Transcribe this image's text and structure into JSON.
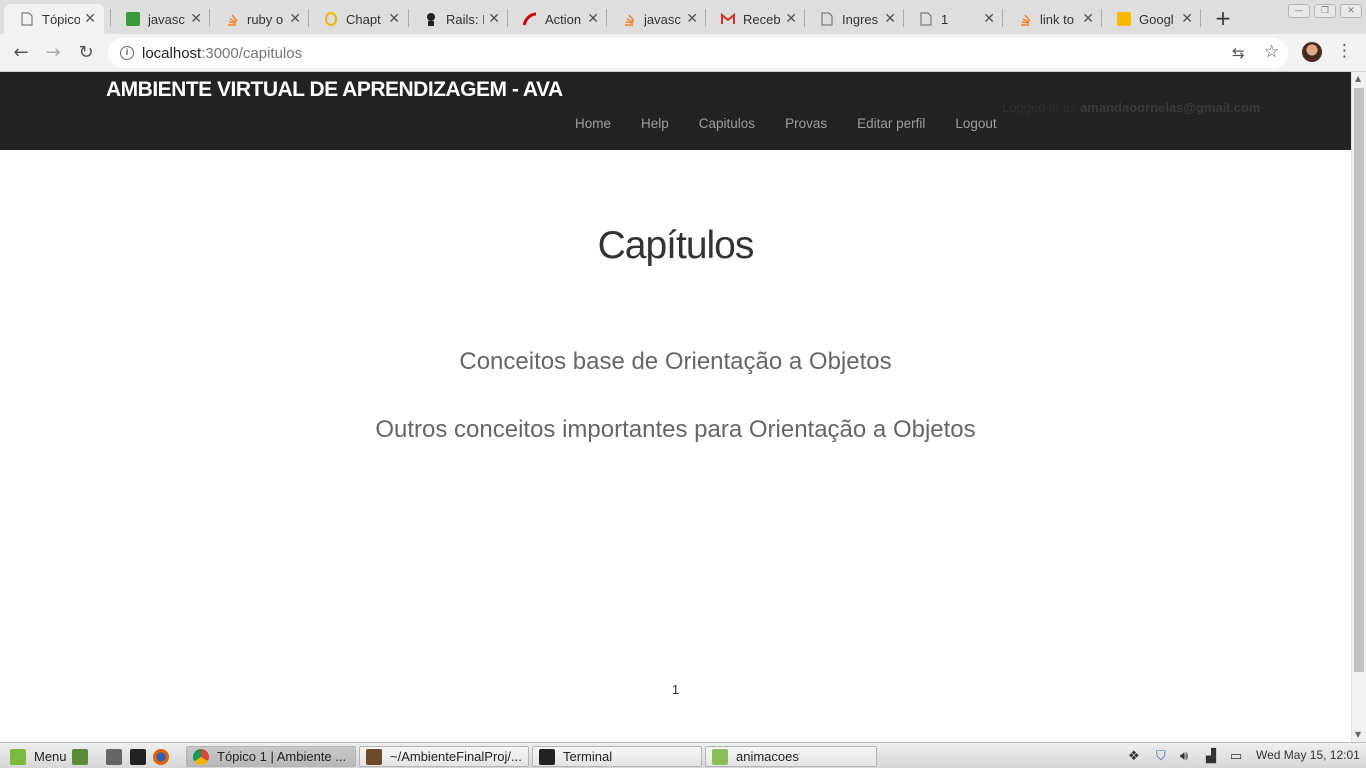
{
  "browser": {
    "tabs": [
      {
        "title": "Tópico",
        "icon": "page-icon",
        "active": true
      },
      {
        "title": "javasc",
        "icon": "stackoverflow-green-icon"
      },
      {
        "title": "ruby o",
        "icon": "stackoverflow-icon"
      },
      {
        "title": "Chapt",
        "icon": "opera-o-icon"
      },
      {
        "title": "Rails: I",
        "icon": "ninja-icon"
      },
      {
        "title": "Action",
        "icon": "rails-icon"
      },
      {
        "title": "javasc",
        "icon": "stackoverflow-icon"
      },
      {
        "title": "Receb",
        "icon": "gmail-icon"
      },
      {
        "title": "Ingres",
        "icon": "page-icon"
      },
      {
        "title": "1",
        "icon": "page-icon"
      },
      {
        "title": "link to",
        "icon": "stackoverflow-icon"
      },
      {
        "title": "Googl",
        "icon": "google-keep-icon"
      }
    ],
    "close_glyph": "✕",
    "new_tab": "+",
    "window_controls": {
      "minimize": "—",
      "restore": "❐",
      "close": "✕"
    },
    "back": "←",
    "forward": "→",
    "reload": "↻",
    "info": "i",
    "url_host": "localhost",
    "url_path": ":3000/capitulos",
    "translate": "⇆",
    "star": "☆",
    "menu": "⋮"
  },
  "app": {
    "brand": "AMBIENTE VIRTUAL DE APRENDIZAGEM - AVA",
    "nav": [
      "Home",
      "Help",
      "Capitulos",
      "Provas",
      "Editar perfil",
      "Logout"
    ],
    "logged_in_prefix": "Logged in as",
    "logged_in_user": "amandaoornelas@gmail.com"
  },
  "page": {
    "title": "Capítulos",
    "chapters": [
      "Conceitos base de Orientação a Objetos",
      "Outros conceitos importantes para Orientação a Objetos"
    ],
    "pagination": "1"
  },
  "taskbar": {
    "menu_label": "Menu",
    "windows": [
      {
        "title": "Tópico 1 | Ambiente ...",
        "active": true
      },
      {
        "title": "~/AmbienteFinalProj/..."
      },
      {
        "title": "Terminal"
      },
      {
        "title": "animacoes"
      }
    ],
    "clock": "Wed May 15, 12:01"
  },
  "colors": {
    "navbar": "#222222",
    "nav_text": "#9d9d9d",
    "heading": "#333333",
    "chapter_text": "#666666"
  }
}
